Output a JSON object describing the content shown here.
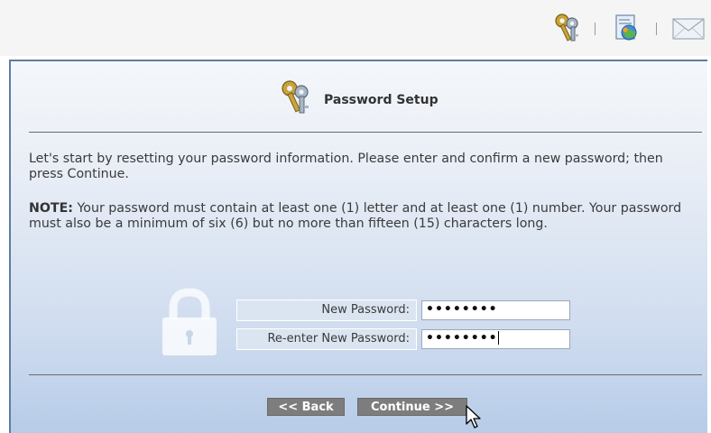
{
  "toolbar": {
    "icons": [
      "keys-icon",
      "globe-document-icon",
      "envelope-icon"
    ]
  },
  "dialog": {
    "title": "Password Setup",
    "intro": "Let's start by resetting your password information. Please enter and confirm a new password; then press Continue.",
    "note_label": "NOTE:",
    "note_text": " Your password must contain at least one (1) letter and at least one (1) number. Your password must also be a minimum of six (6) but no more than fifteen (15) characters long."
  },
  "form": {
    "new_password_label": "New Password:",
    "new_password_value": "••••••••",
    "reenter_password_label": "Re-enter New Password:",
    "reenter_password_value": "••••••••"
  },
  "buttons": {
    "back_label": "<< Back",
    "continue_label": "Continue >>"
  }
}
